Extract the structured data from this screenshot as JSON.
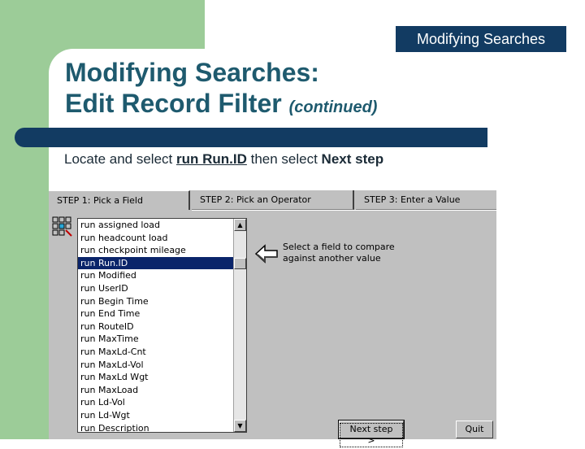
{
  "header": {
    "badge": "Modifying Searches"
  },
  "slide": {
    "title_line1": "Modifying Searches:",
    "title_line2": "Edit Record Filter",
    "title_suffix": "(continued)",
    "instruction": {
      "pre": "Locate and select ",
      "field": "run Run.ID",
      "mid": " then select ",
      "action": "Next step"
    }
  },
  "app": {
    "tabs": [
      "STEP 1: Pick a Field",
      "STEP 2: Pick an Operator",
      "STEP 3: Enter a Value"
    ],
    "active_tab": 0,
    "fields": [
      "run assigned load",
      "run headcount load",
      "run checkpoint mileage",
      "run Run.ID",
      "run Modified",
      "run UserID",
      "run Begin Time",
      "run End Time",
      "run RouteID",
      "run MaxTime",
      "run MaxLd-Cnt",
      "run MaxLd-Vol",
      "run MaxLd Wgt",
      "run MaxLoad",
      "run Ld-Vol",
      "run Ld-Wgt",
      "run Description"
    ],
    "selected_field": "run Run.ID",
    "hint_line1": "Select a field to compare",
    "hint_line2": "against another value",
    "next_button": "Next step >",
    "quit_button": "Quit",
    "icons": {
      "field_picker": "field-picker-icon",
      "arrow": "left-arrow-icon"
    }
  },
  "colors": {
    "green": "#9ccc98",
    "navy": "#123b62",
    "title": "#1e5a6e",
    "selection": "#0a246a"
  }
}
